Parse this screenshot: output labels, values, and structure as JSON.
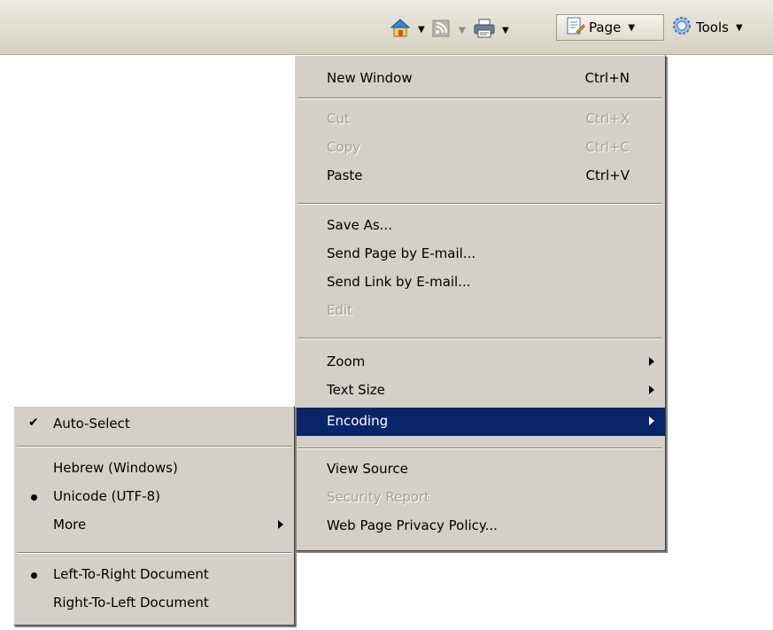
{
  "toolbar": {
    "page_label": "Page",
    "tools_label": "Tools",
    "icons": [
      "home-icon",
      "feed-icon",
      "print-icon",
      "page-icon",
      "tools-gear-icon"
    ]
  },
  "page_menu": {
    "items": [
      {
        "label": "New Window",
        "shortcut": "Ctrl+N"
      },
      {
        "label": "Cut",
        "shortcut": "Ctrl+X"
      },
      {
        "label": "Copy",
        "shortcut": "Ctrl+C"
      },
      {
        "label": "Paste",
        "shortcut": "Ctrl+V"
      },
      {
        "label": "Save As..."
      },
      {
        "label": "Send Page by E-mail..."
      },
      {
        "label": "Send Link by E-mail..."
      },
      {
        "label": "Edit"
      },
      {
        "label": "Zoom"
      },
      {
        "label": "Text Size"
      },
      {
        "label": "Encoding"
      },
      {
        "label": "View Source"
      },
      {
        "label": "Security Report"
      },
      {
        "label": "Web Page Privacy Policy..."
      }
    ]
  },
  "encoding_submenu": {
    "items": [
      {
        "label": "Auto-Select"
      },
      {
        "label": "Hebrew (Windows)"
      },
      {
        "label": "Unicode (UTF-8)"
      },
      {
        "label": "More"
      },
      {
        "label": "Left-To-Right Document"
      },
      {
        "label": "Right-To-Left Document"
      }
    ]
  },
  "colors": {
    "menu_bg": "#d4d0c8",
    "highlight": "#0a246a",
    "disabled_text": "#a3a095"
  }
}
